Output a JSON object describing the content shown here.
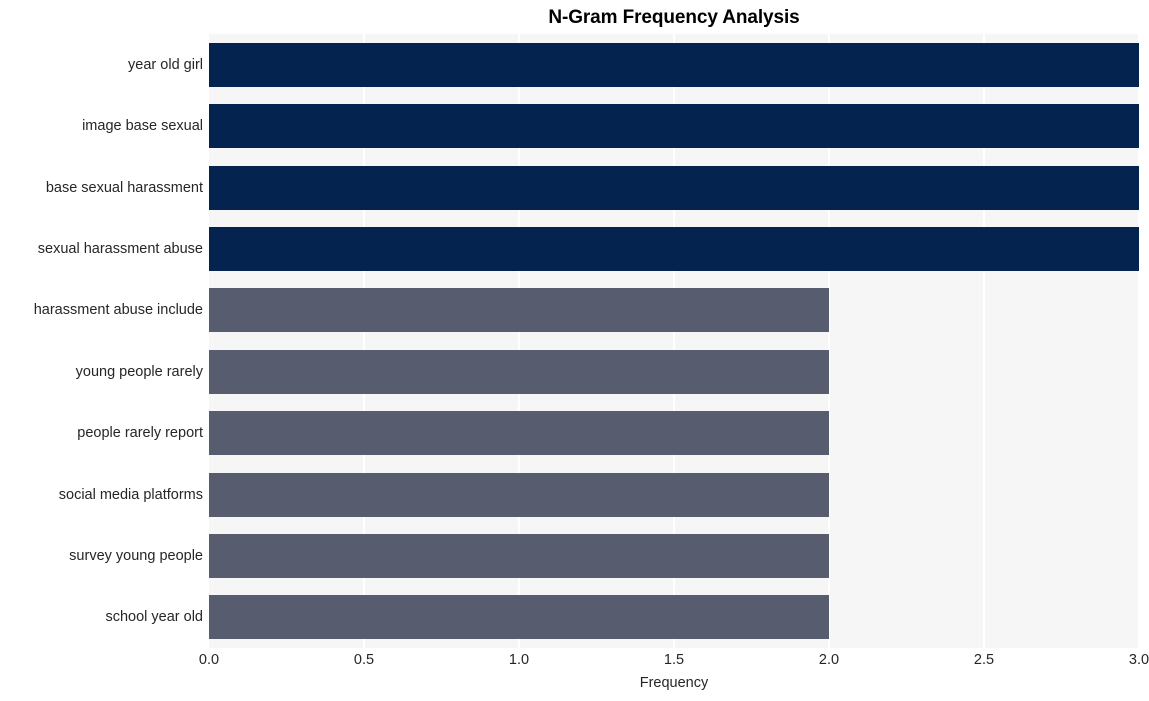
{
  "chart_data": {
    "type": "bar",
    "orientation": "horizontal",
    "title": "N-Gram Frequency Analysis",
    "xlabel": "Frequency",
    "ylabel": "",
    "xlim": [
      0.0,
      3.0
    ],
    "grid": true,
    "legend": null,
    "xticks": [
      "0.0",
      "0.5",
      "1.0",
      "1.5",
      "2.0",
      "2.5",
      "3.0"
    ],
    "xtick_values": [
      0.0,
      0.5,
      1.0,
      1.5,
      2.0,
      2.5,
      3.0
    ],
    "categories": [
      "year old girl",
      "image base sexual",
      "base sexual harassment",
      "sexual harassment abuse",
      "harassment abuse include",
      "young people rarely",
      "people rarely report",
      "social media platforms",
      "survey young people",
      "school year old"
    ],
    "values": [
      3,
      3,
      3,
      3,
      2,
      2,
      2,
      2,
      2,
      2
    ],
    "bar_colors": [
      "#04234f",
      "#04234f",
      "#04234f",
      "#04234f",
      "#575c6e",
      "#575c6e",
      "#575c6e",
      "#575c6e",
      "#575c6e",
      "#575c6e"
    ]
  },
  "style": {
    "plot_background": "#f6f6f7",
    "figure_background": "#ffffff",
    "gridline_color": "#ffffff",
    "text_color": "#262626",
    "title_color": "#000000",
    "accent_high": "#04234f",
    "accent_low": "#575c6e"
  }
}
